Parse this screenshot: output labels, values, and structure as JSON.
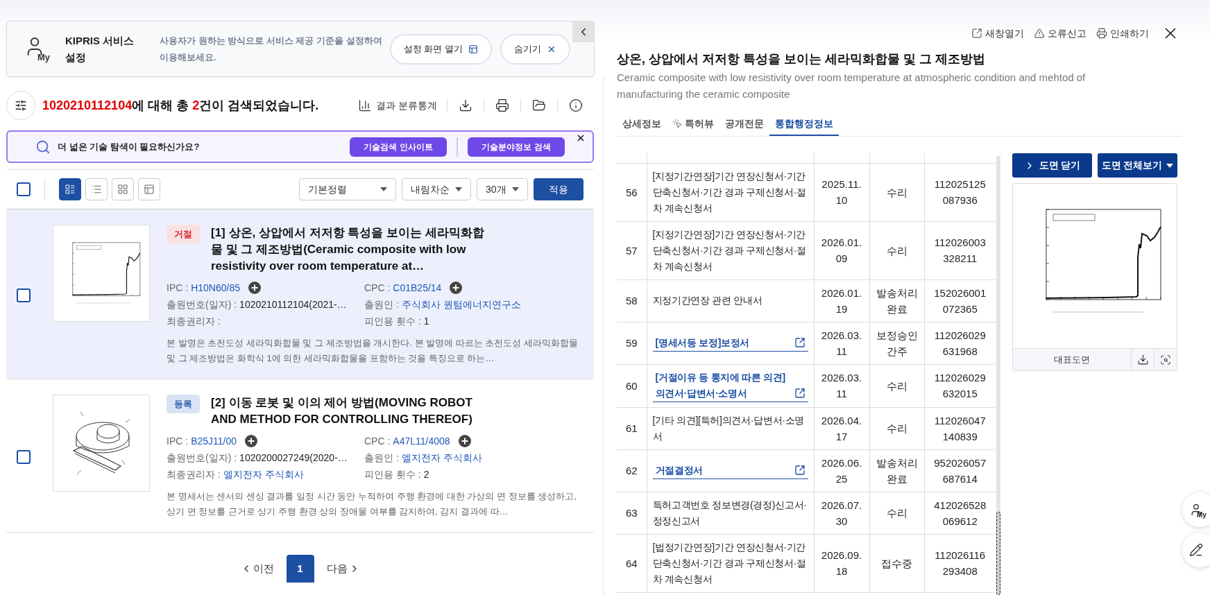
{
  "settings_card": {
    "icon_text": "My",
    "title": "KIPRIS 서비스 설정",
    "description": "사용자가 원하는 방식으로 서비스 제공 기준을 설정하여 이용해보세요.",
    "buttons": [
      {
        "kind": "open",
        "label": "설정 화면 열기"
      },
      {
        "kind": "hide",
        "label": "숨기기"
      }
    ]
  },
  "result_summary": {
    "query": "1020210112104",
    "middle": "에 대해 총 ",
    "count": "2",
    "tail": "건이 검색되었습니다."
  },
  "result_tools": [
    {
      "kind": "stats",
      "label": "결과 분류통계"
    },
    {
      "kind": "download"
    },
    {
      "kind": "print"
    },
    {
      "kind": "folder"
    },
    {
      "kind": "info"
    }
  ],
  "banner": {
    "text": "더 넓은 기술 탐색이 필요하신가요?",
    "buttons": [
      "기술검색 인사이트",
      "기술분야정보 검색"
    ]
  },
  "toolbar": {
    "select_all_checked": false,
    "view_modes": [
      {
        "kind": "detail",
        "selected": true
      },
      {
        "kind": "list",
        "selected": false
      },
      {
        "kind": "grid",
        "selected": false
      },
      {
        "kind": "split",
        "selected": false
      }
    ],
    "sort": "기본정렬",
    "order": "내림차순",
    "page_size": "30개",
    "apply": "적용"
  },
  "results": [
    {
      "checked": false,
      "selected": true,
      "thumbnail": {
        "kind": "graph"
      },
      "status": {
        "label": "거절",
        "kind": "rejected"
      },
      "title": "[1] 상온, 상압에서 저저항 특성을 보이는 세라믹화합물 및 그 제조방법(Ceramic composite with low resistivity over room temperature at…",
      "fields": [
        {
          "label": "IPC :",
          "value": "H10N60/85",
          "kind": "code"
        },
        {
          "label": "CPC :",
          "value": "C01B25/14",
          "kind": "code"
        },
        {
          "label": "출원번호(일자) :",
          "value": "1020210112104(2021-…",
          "kind": "text"
        },
        {
          "label": "출원인 :",
          "value": "주식회사 퀀텀에너지연구소",
          "kind": "link"
        },
        {
          "label": "최종권리자 :",
          "kind": "empty"
        },
        {
          "label": "피인용 횟수 :",
          "value": "1",
          "kind": "text"
        }
      ],
      "abstract": "본 발명은 초전도성 세라믹화합물 및 그 제조방법을 개시한다. 본 발명에 따르는 초전도성 세라믹화합물 및 그 제조방법은 화학식 1에 의한 세라믹화합물을 포함하는 것을 특징으로 하는…"
    },
    {
      "checked": false,
      "selected": false,
      "thumbnail": {
        "kind": "device"
      },
      "status": {
        "label": "등록",
        "kind": "registered"
      },
      "title": "[2] 이동 로봇 및 이의 제어 방법(MOVING ROBOT AND METHOD FOR CONTROLLING THEREOF)",
      "fields": [
        {
          "label": "IPC :",
          "value": "B25J11/00",
          "kind": "code"
        },
        {
          "label": "CPC :",
          "value": "A47L11/4008",
          "kind": "code"
        },
        {
          "label": "출원번호(일자) :",
          "value": "1020200027249(2020-…",
          "kind": "text"
        },
        {
          "label": "출원인 :",
          "value": "엘지전자 주식회사",
          "kind": "link"
        },
        {
          "label": "최종권리자 :",
          "value": "엘지전자 주식회사",
          "kind": "link"
        },
        {
          "label": "피인용 횟수 :",
          "value": "2",
          "kind": "text"
        }
      ],
      "abstract": "본 명세서는 센서의 센싱 결과를 일정 시간 동안 누적하여 주행 환경에 대한 가상의 면 정보를 생성하고, 상기 면 정보를 근거로 상기 주행 환경 상의 장애물 여부를 감지하여, 감지 결과에 따…"
    }
  ],
  "pagination": {
    "prev": "이전",
    "pages": [
      {
        "label": "1",
        "selected": true
      }
    ],
    "next": "다음"
  },
  "detail": {
    "actions": [
      {
        "kind": "new-window",
        "label": "새창열기"
      },
      {
        "kind": "report",
        "label": "오류신고"
      },
      {
        "kind": "print",
        "label": "인쇄하기"
      }
    ],
    "title": "상온, 상압에서 저저항 특성을 보이는 세라믹화합물 및 그 제조방법",
    "title_en": "Ceramic composite with low resistivity over room temperature at atmospheric condition and mehtod of manufacturing the ceramic composite",
    "tabs": [
      {
        "label": "상세정보",
        "selected": false
      },
      {
        "label": "특허뷰",
        "selected": false,
        "kind": "icon"
      },
      {
        "label": "공개전문",
        "selected": false
      },
      {
        "label": "통합행정정보",
        "selected": true
      }
    ],
    "rows": [
      {
        "no": "56",
        "document": "[지정기간연장]기간 연장신청서·기간 단축신청서·기간 경과 구제신청서·절차 계속신청서",
        "link": false,
        "date": "2025.11.10",
        "status": "수리",
        "number": "112025125087936"
      },
      {
        "no": "57",
        "document": "[지정기간연장]기간 연장신청서·기간 단축신청서·기간 경과 구제신청서·절차 계속신청서",
        "link": false,
        "date": "2026.01.09",
        "status": "수리",
        "number": "112026003328211"
      },
      {
        "no": "58",
        "document": "지정기간연장 관련 안내서",
        "link": false,
        "date": "2026.01.19",
        "status": "발송처리 완료",
        "number": "152026001072365"
      },
      {
        "no": "59",
        "document": "[명세서등 보정]보정서",
        "link": true,
        "date": "2026.03.11",
        "status": "보정승인 간주",
        "number": "112026029631968"
      },
      {
        "no": "60",
        "document": "[거절이유 등 통지에 따른 의견]의견서·답변서·소명서",
        "link": true,
        "date": "2026.03.11",
        "status": "수리",
        "number": "112026029632015"
      },
      {
        "no": "61",
        "document": "[기타 의견][특허]의견서·답변서·소명서",
        "link": false,
        "date": "2026.04.17",
        "status": "수리",
        "number": "112026047140839"
      },
      {
        "no": "62",
        "document": "거절결정서",
        "link": true,
        "date": "2026.06.25",
        "status": "발송처리 완료",
        "number": "952026057687614"
      },
      {
        "no": "63",
        "document": "특허고객번호 정보변경(경정)신고서·정정신고서",
        "link": false,
        "date": "2026.07.30",
        "status": "수리",
        "number": "412026528069612"
      },
      {
        "no": "64",
        "document": "[법정기간연장]기간 연장신청서·기간 단축신청서·기간 경과 구제신청서·절차 계속신청서",
        "link": false,
        "date": "2026.09.18",
        "status": "접수중",
        "number": "112026116293408"
      }
    ],
    "drawing_panel": {
      "buttons": [
        {
          "kind": "close",
          "label": "도면 닫기"
        },
        {
          "kind": "all",
          "label": "도면 전체보기"
        }
      ],
      "caption": "대표도면"
    }
  },
  "floating_buttons": [
    {
      "kind": "my",
      "label": "My"
    },
    {
      "kind": "edit"
    }
  ]
}
